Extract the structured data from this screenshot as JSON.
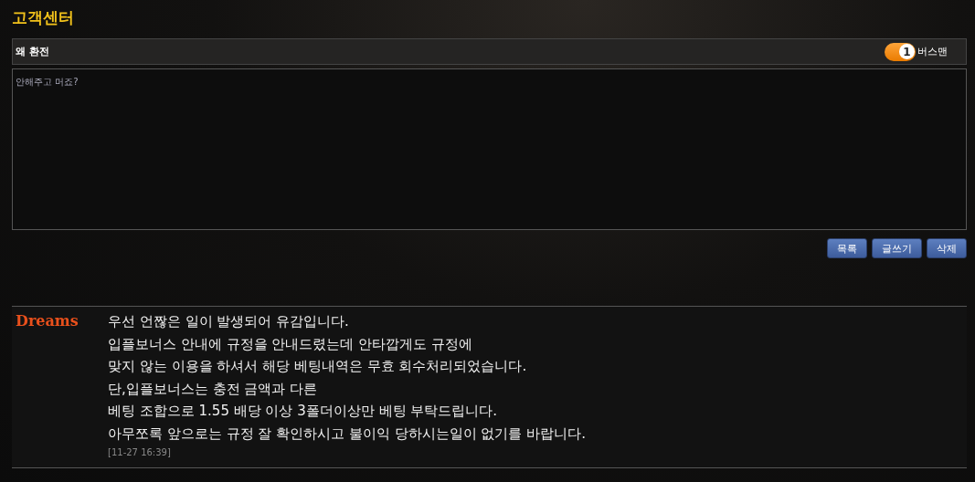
{
  "page_title": "고객센터",
  "post": {
    "title": "왜 환전",
    "author": {
      "level": "1",
      "name": "버스맨"
    },
    "body": "안해주고 머죠?"
  },
  "buttons": [
    {
      "label": "목록"
    },
    {
      "label": "글쓰기"
    },
    {
      "label": "삭제"
    }
  ],
  "reply": {
    "logo": "Dreams",
    "lines": [
      "우선 언짢은 일이 발생되어 유감입니다.",
      "입플보너스 안내에 규정을 안내드렸는데 안타깝게도 규정에",
      "맞지 않는 이용을 하셔서 해당 베팅내역은 무효 회수처리되었습니다.",
      "단,입플보너스는 충전 금액과 다른",
      "베팅 조합으로 1.55 배당 이상 3폴더이상만 베팅 부탁드립니다.",
      "아무쪼록 앞으로는 규정 잘 확인하시고 불이익 당하시는일이 없기를 바랍니다."
    ],
    "time": "[11-27 16:39]"
  }
}
